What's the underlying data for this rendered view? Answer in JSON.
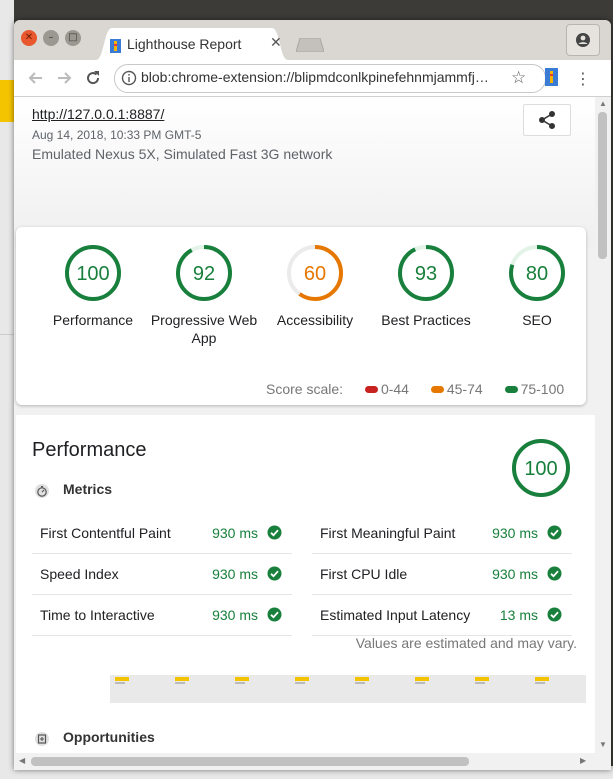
{
  "browser": {
    "tab_title": "Lighthouse Report",
    "url": "blob:chrome-extension://blipmdconlkpinefehnmjammfj…",
    "colors": {
      "accent_favicon": "#3a7bd5"
    }
  },
  "report": {
    "url": "http://127.0.0.1:8887/",
    "date": "Aug 14, 2018, 10:33 PM GMT-5",
    "environment": "Emulated Nexus 5X, Simulated Fast 3G network",
    "categories": [
      {
        "label": "Performance",
        "score": "100",
        "level": 1.0,
        "color": "#18803c",
        "track": "#e3f3e8"
      },
      {
        "label": "Progressive Web App",
        "score": "92",
        "level": 0.92,
        "color": "#18803c",
        "track": "#e3f3e8"
      },
      {
        "label": "Accessibility",
        "score": "60",
        "level": 0.6,
        "color": "#e67700",
        "track": "#ebebeb"
      },
      {
        "label": "Best Practices",
        "score": "93",
        "level": 0.93,
        "color": "#18803c",
        "track": "#e3f3e8"
      },
      {
        "label": "SEO",
        "score": "80",
        "level": 0.8,
        "color": "#18803c",
        "track": "#e3f3e8"
      }
    ],
    "scale": {
      "label": "Score scale:",
      "ranges": [
        {
          "label": "0-44",
          "color": "#c7221f"
        },
        {
          "label": "45-74",
          "color": "#e67700"
        },
        {
          "label": "75-100",
          "color": "#18803c"
        }
      ]
    },
    "performance": {
      "title": "Performance",
      "score": "100",
      "level": 1.0,
      "metrics_title": "Metrics",
      "metrics": [
        {
          "name": "First Contentful Paint",
          "value": "930 ms"
        },
        {
          "name": "First Meaningful Paint",
          "value": "930 ms"
        },
        {
          "name": "Speed Index",
          "value": "930 ms"
        },
        {
          "name": "First CPU Idle",
          "value": "930 ms"
        },
        {
          "name": "Time to Interactive",
          "value": "930 ms"
        },
        {
          "name": "Estimated Input Latency",
          "value": "13 ms"
        }
      ],
      "disclaimer": "Values are estimated and may vary.",
      "opportunities_title": "Opportunities"
    }
  }
}
